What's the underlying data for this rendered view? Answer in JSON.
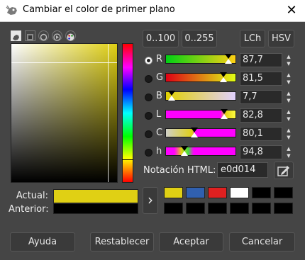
{
  "window": {
    "title": "Cambiar el color de primer plano",
    "close_glyph": "✕"
  },
  "tabs": [
    "gimp-selector-icon",
    "cmyk-icon",
    "watercolor-icon",
    "wheel-icon",
    "palette-icon"
  ],
  "range_buttons": [
    "0..100",
    "0..255"
  ],
  "mode_buttons": [
    "LCh",
    "HSV"
  ],
  "channels": [
    {
      "label": "R",
      "value": "87,7",
      "selected": true
    },
    {
      "label": "G",
      "value": "81,5",
      "selected": false
    },
    {
      "label": "B",
      "value": "7,7",
      "selected": false
    },
    {
      "label": "L",
      "value": "82,8",
      "selected": false
    },
    {
      "label": "C",
      "value": "80,1",
      "selected": false
    },
    {
      "label": "h",
      "value": "94,8",
      "selected": false
    }
  ],
  "spinner_up": "▲",
  "spinner_down": "▼",
  "html_notation": {
    "label": "Notación HTML:",
    "value": "e0d014"
  },
  "compare": {
    "current_label": "Actual:",
    "previous_label": "Anterior:",
    "current_color": "#e0d014",
    "previous_color": "#000000"
  },
  "history_arrow": "›",
  "history": [
    "#e0d014",
    "#3060b0",
    "#e02020",
    "#ffffff",
    "#000000",
    "#000000",
    "#000000",
    "#000000",
    "#000000",
    "#000000",
    "#000000",
    "#000000"
  ],
  "footer": {
    "help": "Ayuda",
    "reset": "Restablecer",
    "ok": "Aceptar",
    "cancel": "Cancelar"
  }
}
